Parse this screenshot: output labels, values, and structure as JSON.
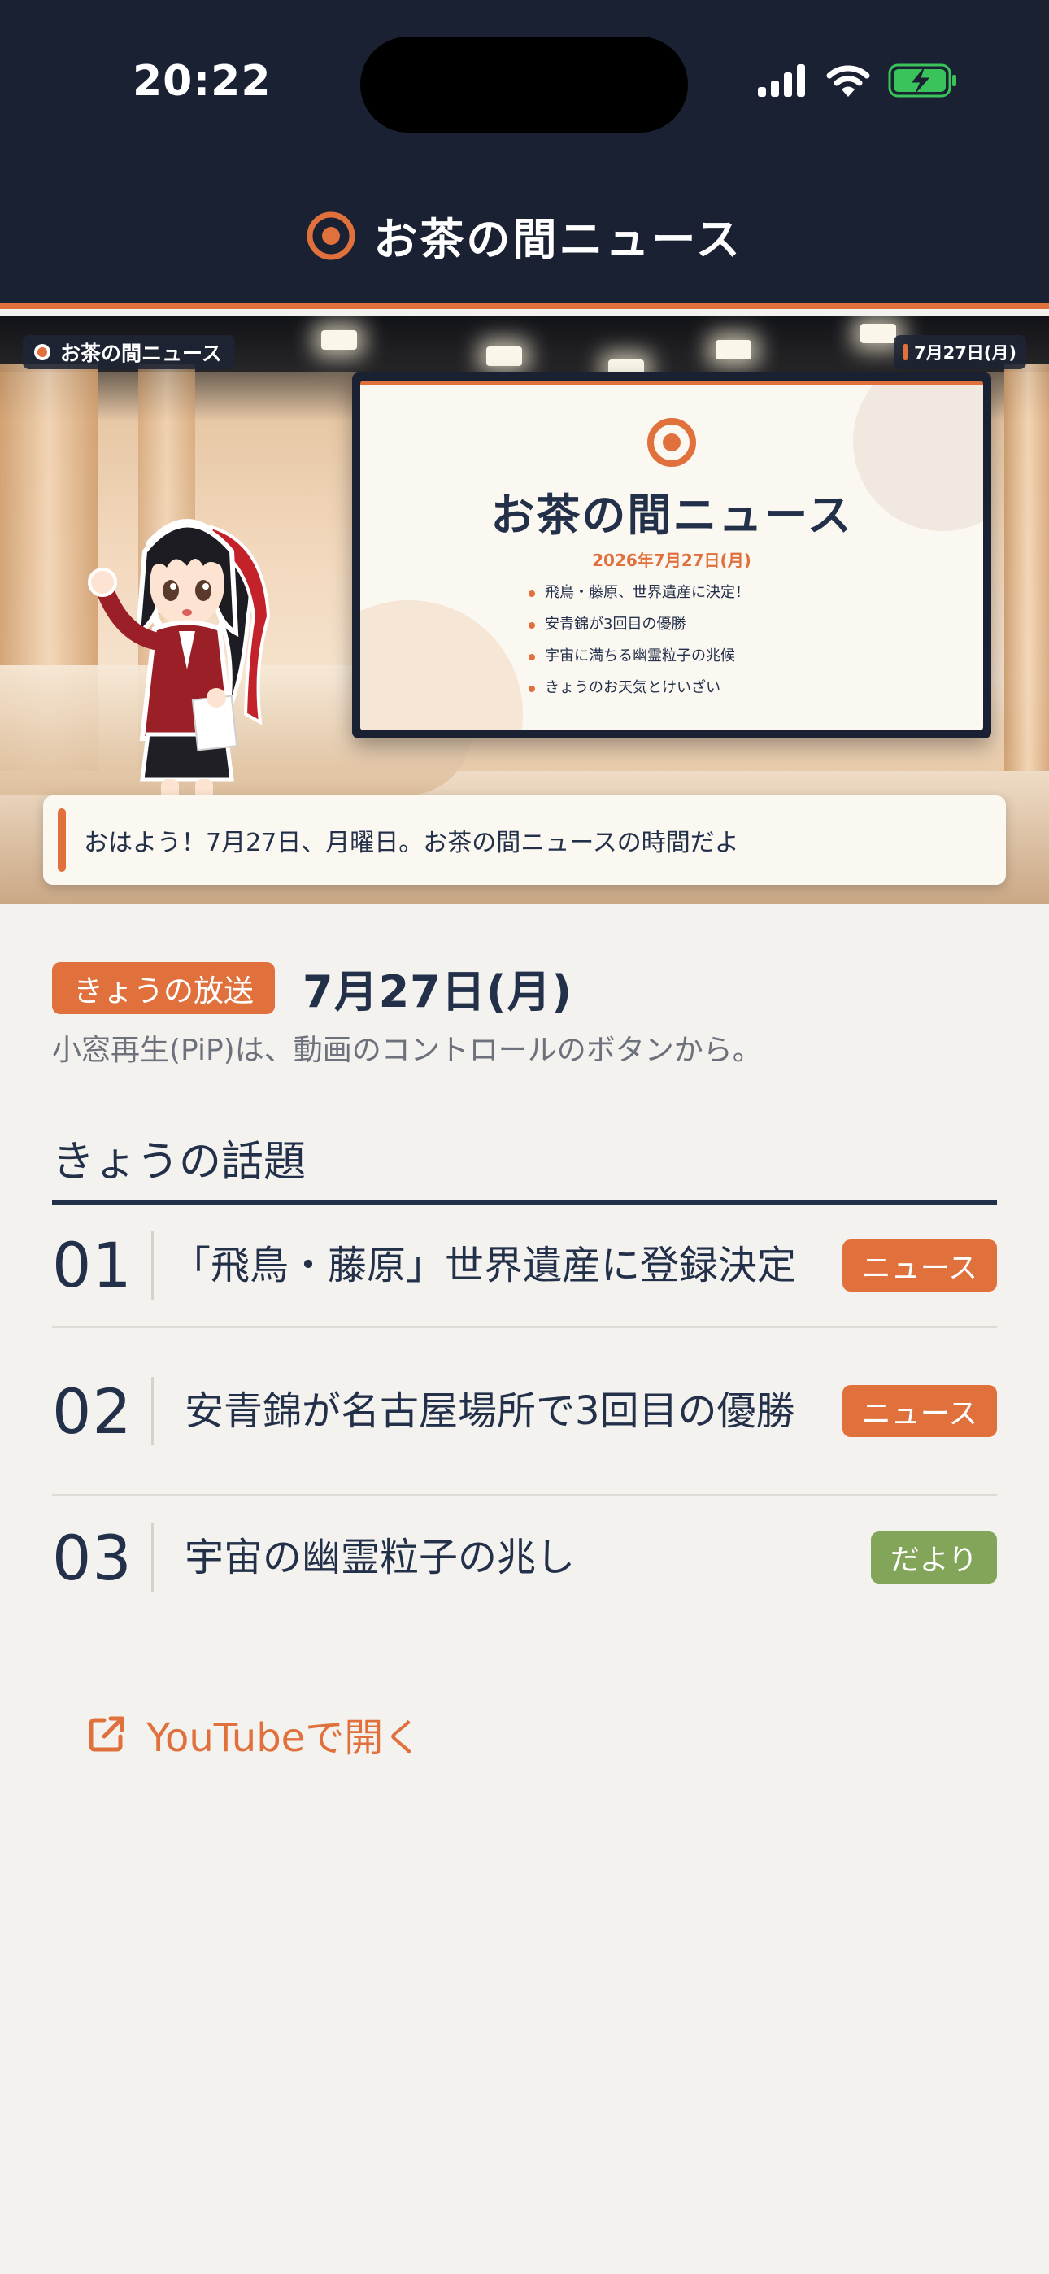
{
  "status_bar": {
    "time": "20:22"
  },
  "header": {
    "title": "お茶の間ニュース",
    "icon": "target-logo-icon",
    "accent_color": "#e0703c",
    "background_color": "#1a2132"
  },
  "video": {
    "channel_badge": "お茶の間ニュース",
    "date_badge": "7月27日(月)",
    "screen": {
      "title": "お茶の間ニュース",
      "date": "2026年7月27日(月)",
      "items": [
        "飛鳥・藤原、世界遺産に決定！",
        "安青錦が3回目の優勝",
        "宇宙に満ちる幽霊粒子の兆候",
        "きょうのお天気とけいざい"
      ]
    },
    "caption": "おはよう！7月27日、月曜日。お茶の間ニュースの時間だよ"
  },
  "today": {
    "badge": "きょうの放送",
    "date": "7月27日(月)",
    "pip_note": "小窓再生(PiP)は、動画のコントロールのボタンから。"
  },
  "topics": {
    "section_title": "きょうの話題",
    "items": [
      {
        "number": "01",
        "title": "「飛鳥・藤原」世界遺産に登録決定",
        "tag": "ニュース",
        "tag_color": "#e0703c"
      },
      {
        "number": "02",
        "title": "安青錦が名古屋場所で3回目の優勝",
        "tag": "ニュース",
        "tag_color": "#e0703c"
      },
      {
        "number": "03",
        "title": "宇宙の幽霊粒子の兆し",
        "tag": "だより",
        "tag_color": "#82a55a"
      }
    ]
  },
  "actions": {
    "open_youtube": "YouTubeで開く",
    "open_youtube_icon": "external-link-icon"
  }
}
